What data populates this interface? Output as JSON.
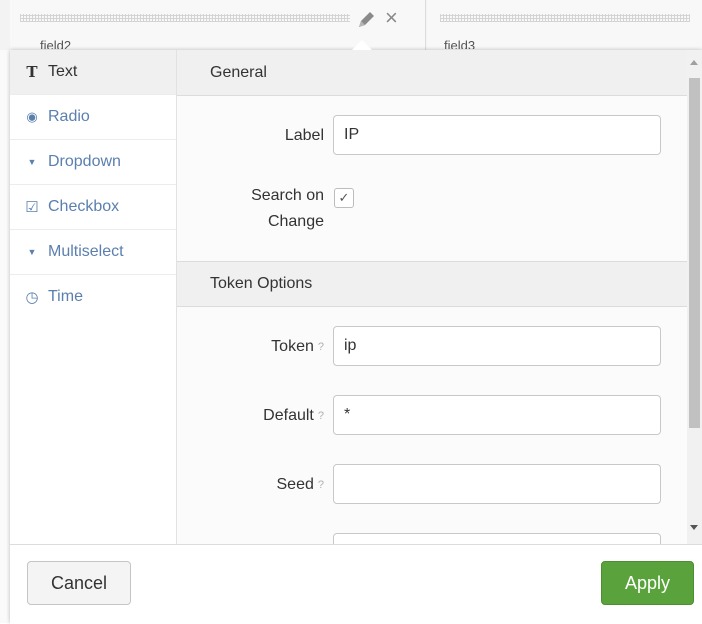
{
  "background": {
    "field_labels": [
      "field2",
      "field3"
    ]
  },
  "sidebar": {
    "items": [
      {
        "label": "Text",
        "icon": "text-type-icon",
        "glyph": "T",
        "active": true
      },
      {
        "label": "Radio",
        "icon": "radio-icon",
        "glyph": "◉",
        "active": false
      },
      {
        "label": "Dropdown",
        "icon": "caret-down-icon",
        "glyph": "▼",
        "active": false
      },
      {
        "label": "Checkbox",
        "icon": "checkbox-icon",
        "glyph": "☑",
        "active": false
      },
      {
        "label": "Multiselect",
        "icon": "caret-down-icon",
        "glyph": "▼",
        "active": false
      },
      {
        "label": "Time",
        "icon": "clock-icon",
        "glyph": "◷",
        "active": false
      }
    ]
  },
  "general": {
    "heading": "General",
    "label_caption": "Label",
    "label_value": "IP",
    "search_on_change_line1": "Search on",
    "search_on_change_line2": "Change",
    "search_on_change_checked": "✓"
  },
  "token_options": {
    "heading": "Token Options",
    "token_caption": "Token",
    "token_value": "ip",
    "default_caption": "Default",
    "default_value": "*",
    "seed_caption": "Seed",
    "seed_value": "",
    "help_glyph": "?"
  },
  "footer": {
    "cancel_label": "Cancel",
    "apply_label": "Apply"
  },
  "colors": {
    "apply_green": "#5aa33c",
    "link_blue": "#5b7fae"
  }
}
